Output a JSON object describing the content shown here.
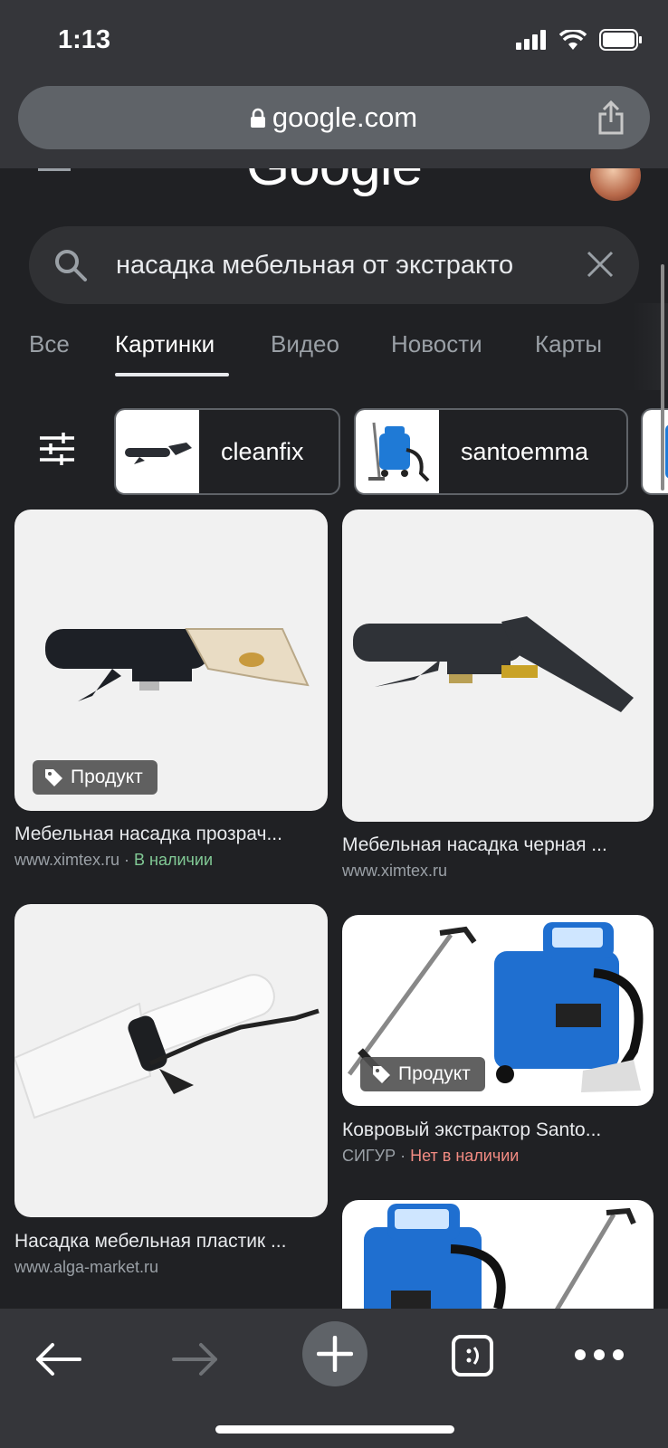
{
  "status_bar": {
    "time": "1:13"
  },
  "browser": {
    "url": "google.com"
  },
  "google": {
    "logo": "Google"
  },
  "search": {
    "query": "насадка мебельная от экстракто"
  },
  "tabs": [
    {
      "label": "Все"
    },
    {
      "label": "Картинки"
    },
    {
      "label": "Видео"
    },
    {
      "label": "Новости"
    },
    {
      "label": "Карты"
    }
  ],
  "chips": [
    {
      "label": "cleanfix"
    },
    {
      "label": "santoemma"
    }
  ],
  "results": [
    {
      "title": "Мебельная насадка прозрач...",
      "source": "www.ximtex.ru",
      "separator": " · ",
      "availability": "В наличии",
      "badge": "Продукт"
    },
    {
      "title": "Мебельная насадка черная ...",
      "source": "www.ximtex.ru"
    },
    {
      "title": "Насадка мебельная пластик ...",
      "source": "www.alga-market.ru"
    },
    {
      "title": "Ковровый экстрактор Santo...",
      "source": "СИГУР",
      "separator": " · ",
      "availability": "Нет в наличии",
      "badge": "Продукт"
    }
  ],
  "colors": {
    "in_stock": "#81c995",
    "out_of_stock": "#f28b82",
    "background": "#202124"
  }
}
